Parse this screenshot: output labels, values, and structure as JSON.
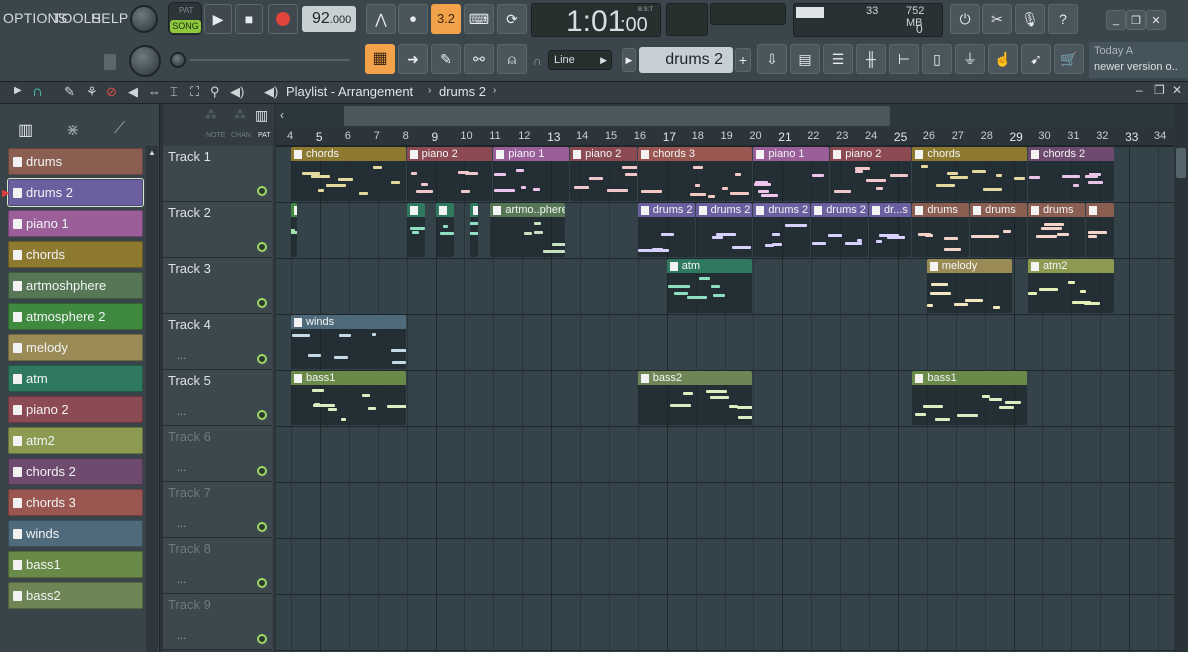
{
  "menu": {
    "options": "OPTIONS",
    "tools": "TOOLS",
    "help": "HELP"
  },
  "transport": {
    "pat": "PAT",
    "song": "SONG",
    "tempo": "92",
    "tempo_dec": ".000",
    "time": "1:01",
    "time_small": ":00",
    "bst": "B:S:T",
    "beat_step": "3.2"
  },
  "monitor": {
    "cpu": "33",
    "ram": "752 MB",
    "voices": "0"
  },
  "toolbar": {
    "snap": "Line",
    "pattern": "drums 2",
    "add": "+"
  },
  "news": {
    "line1": "Today  A",
    "line2": "newer version o.."
  },
  "playlist": {
    "title": "Playlist - Arrangement",
    "current": "drums 2",
    "col_note": "NOTE",
    "col_chan": "CHAN",
    "col_pat": "PAT"
  },
  "patterns": [
    {
      "label": "drums",
      "color": "#8a5f52"
    },
    {
      "label": "drums 2",
      "color": "#6c5fa0"
    },
    {
      "label": "piano 1",
      "color": "#9a5e99"
    },
    {
      "label": "chords",
      "color": "#8d7a30"
    },
    {
      "label": "artmoshphere",
      "color": "#567656"
    },
    {
      "label": "atmosphere 2",
      "color": "#3f8a3f"
    },
    {
      "label": "melody",
      "color": "#9a8a56"
    },
    {
      "label": "atm",
      "color": "#2f7a5e"
    },
    {
      "label": "piano 2",
      "color": "#8c4a52"
    },
    {
      "label": "atm2",
      "color": "#8c9a52"
    },
    {
      "label": "chords 2",
      "color": "#6e4a6e"
    },
    {
      "label": "chords 3",
      "color": "#9a5650"
    },
    {
      "label": "winds",
      "color": "#4f6a7a"
    },
    {
      "label": "bass1",
      "color": "#6a8a4a"
    },
    {
      "label": "bass2",
      "color": "#6e8656"
    }
  ],
  "tracks": [
    {
      "label": "Track 1",
      "dots": ""
    },
    {
      "label": "Track 2",
      "dots": ""
    },
    {
      "label": "Track 3",
      "dots": ""
    },
    {
      "label": "Track 4",
      "dots": "..."
    },
    {
      "label": "Track 5",
      "dots": "..."
    },
    {
      "label": "Track 6",
      "dots": "..."
    },
    {
      "label": "Track 7",
      "dots": "..."
    },
    {
      "label": "Track 8",
      "dots": "..."
    },
    {
      "label": "Track 9",
      "dots": "..."
    }
  ],
  "ruler": [
    "4",
    "5",
    "6",
    "7",
    "8",
    "9",
    "10",
    "11",
    "12",
    "13",
    "14",
    "15",
    "16",
    "17",
    "18",
    "19",
    "20",
    "21",
    "22",
    "23",
    "24",
    "25",
    "26",
    "27",
    "28",
    "29",
    "30",
    "31",
    "32",
    "33",
    "34"
  ],
  "clips": [
    {
      "track": 1,
      "start": 4,
      "end": 8,
      "label": "chords",
      "color": "#8d7a30",
      "note": "#e6d9a0"
    },
    {
      "track": 1,
      "start": 8,
      "end": 11,
      "label": "piano 2",
      "color": "#8c4a52",
      "note": "#f0c8cc"
    },
    {
      "track": 1,
      "start": 11,
      "end": 13.66,
      "label": "piano 1",
      "color": "#9a5e99",
      "note": "#efc4ee"
    },
    {
      "track": 1,
      "start": 13.66,
      "end": 16,
      "label": "piano 2",
      "color": "#8c4a52",
      "note": "#f0c8cc"
    },
    {
      "track": 1,
      "start": 16,
      "end": 20,
      "label": "chords 3",
      "color": "#9a5650",
      "note": "#f4c8c3"
    },
    {
      "track": 1,
      "start": 20,
      "end": 22.66,
      "label": "piano 1",
      "color": "#9a5e99",
      "note": "#efc4ee"
    },
    {
      "track": 1,
      "start": 22.66,
      "end": 25.5,
      "label": "piano 2",
      "color": "#8c4a52",
      "note": "#f0c8cc"
    },
    {
      "track": 1,
      "start": 25.5,
      "end": 29.5,
      "label": "chords",
      "color": "#8d7a30",
      "note": "#e6d9a0"
    },
    {
      "track": 1,
      "start": 29.5,
      "end": 32.5,
      "label": "chords 2",
      "color": "#6e4a6e",
      "note": "#e9c4e9"
    },
    {
      "track": 2,
      "start": 4,
      "end": 4.1,
      "label": "",
      "color": "#3f8a3f",
      "note": "#9fe0a6"
    },
    {
      "track": 2,
      "start": 8,
      "end": 8.66,
      "label": "",
      "color": "#2f7a5e",
      "note": "#8fe0c0"
    },
    {
      "track": 2,
      "start": 9,
      "end": 9.66,
      "label": "",
      "color": "#2f7a5e",
      "note": "#8fe0c0"
    },
    {
      "track": 2,
      "start": 10.2,
      "end": 10.5,
      "label": "",
      "color": "#2f7a5e",
      "note": "#8fe0c0"
    },
    {
      "track": 2,
      "start": 10.9,
      "end": 13.5,
      "label": "artmo..phere",
      "color": "#567656",
      "note": "#c8e2c0"
    },
    {
      "track": 2,
      "start": 16,
      "end": 18,
      "label": "drums 2",
      "color": "#6c5fa0",
      "note": "#d8d0ff"
    },
    {
      "track": 2,
      "start": 18,
      "end": 20,
      "label": "drums 2",
      "color": "#6c5fa0",
      "note": "#d8d0ff"
    },
    {
      "track": 2,
      "start": 20,
      "end": 22,
      "label": "drums 2",
      "color": "#6c5fa0",
      "note": "#d8d0ff"
    },
    {
      "track": 2,
      "start": 22,
      "end": 24,
      "label": "drums 2",
      "color": "#6c5fa0",
      "note": "#d8d0ff"
    },
    {
      "track": 2,
      "start": 24,
      "end": 25.5,
      "label": "dr...s 2",
      "color": "#6c5fa0",
      "note": "#d8d0ff"
    },
    {
      "track": 2,
      "start": 25.5,
      "end": 27.5,
      "label": "drums",
      "color": "#8a5f52",
      "note": "#f3d4c8"
    },
    {
      "track": 2,
      "start": 27.5,
      "end": 29.5,
      "label": "drums",
      "color": "#8a5f52",
      "note": "#f3d4c8"
    },
    {
      "track": 2,
      "start": 29.5,
      "end": 31.5,
      "label": "drums",
      "color": "#8a5f52",
      "note": "#f3d4c8"
    },
    {
      "track": 2,
      "start": 31.5,
      "end": 32.5,
      "label": "",
      "color": "#8a5f52",
      "note": "#f3d4c8"
    },
    {
      "track": 3,
      "start": 17,
      "end": 20,
      "label": "atm",
      "color": "#2f7a5e",
      "note": "#8fe0c0"
    },
    {
      "track": 3,
      "start": 26,
      "end": 29,
      "label": "melody",
      "color": "#9a8a56",
      "note": "#f3e7c0"
    },
    {
      "track": 3,
      "start": 29.5,
      "end": 32.5,
      "label": "atm2",
      "color": "#8c9a52",
      "note": "#e6efb8"
    },
    {
      "track": 4,
      "start": 4,
      "end": 8,
      "label": "winds",
      "color": "#4f6a7a",
      "note": "#c4dae6"
    },
    {
      "track": 5,
      "start": 4,
      "end": 8,
      "label": "bass1",
      "color": "#6a8a4a",
      "note": "#dbeec2"
    },
    {
      "track": 5,
      "start": 16,
      "end": 20,
      "label": "bass2",
      "color": "#6e8656",
      "note": "#dbeec2"
    },
    {
      "track": 5,
      "start": 25.5,
      "end": 29.5,
      "label": "bass1",
      "color": "#6a8a4a",
      "note": "#dbeec2"
    }
  ]
}
